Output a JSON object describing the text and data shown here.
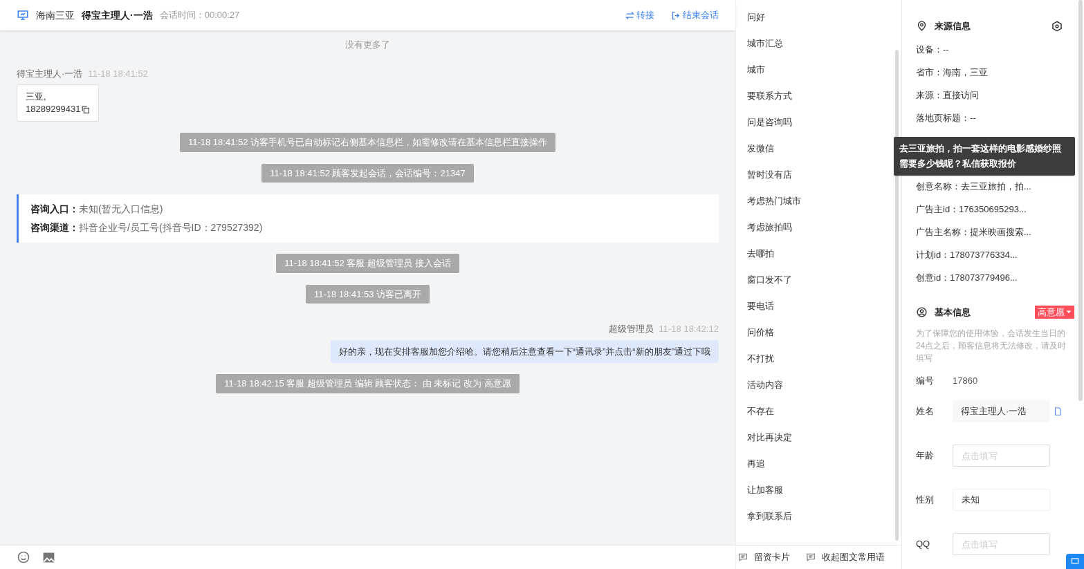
{
  "header": {
    "region": "海南三亚",
    "customer": "得宝主理人·一浩",
    "duration_label": "会话时间：",
    "duration": "00:00:27",
    "actions": [
      {
        "kind": "transfer",
        "label": "转接"
      },
      {
        "kind": "end",
        "label": "结束会话"
      }
    ]
  },
  "chat": {
    "no_more": "没有更多了",
    "items": [
      {
        "kind": "visitor",
        "sender": "得宝主理人·一浩",
        "time": "11-18 18:41:52",
        "lines": [
          "三亚,",
          "18289299431"
        ]
      },
      {
        "kind": "system",
        "text": "11-18 18:41:52 访客手机号已自动标记右侧基本信息栏，如需修改请在基本信息栏直接操作"
      },
      {
        "kind": "system",
        "text": "11-18 18:41:52 顾客发起会话，会话编号：21347"
      },
      {
        "kind": "info",
        "rows": [
          {
            "label": "咨询入口：",
            "value": "未知(暂无入口信息)"
          },
          {
            "label": "咨询渠道：",
            "value": "抖音企业号/员工号(抖音号ID：279527392)"
          }
        ]
      },
      {
        "kind": "system",
        "text": "11-18 18:41:52 客服 超级管理员 接入会话"
      },
      {
        "kind": "system",
        "text": "11-18 18:41:53 访客已离开"
      },
      {
        "kind": "agent",
        "sender": "超级管理员",
        "time": "11-18 18:42:12",
        "text": "好的亲，现在安排客服加您介绍哈。请您稍后注意查看一下“通讯录”并点击“新的朋友”通过下哦"
      },
      {
        "kind": "system",
        "text": "11-18 18:42:15 客服 超级管理员 编辑 顾客状态： 由 未标记 改为 高意愿"
      }
    ]
  },
  "toolbar": {
    "tools": [
      {
        "kind": "emoji"
      },
      {
        "kind": "image"
      }
    ],
    "links": [
      "留资卡片",
      "收起图文常用语"
    ]
  },
  "phrases": [
    "问好",
    "城市汇总",
    "城市",
    "要联系方式",
    "问是咨询吗",
    "发微信",
    "暂时没有店",
    "考虑热门城市",
    "考虑旅拍吗",
    "去哪拍",
    "窗口发不了",
    "要电话",
    "问价格",
    "不打扰",
    "活动内容",
    "不存在",
    "对比再决定",
    "再追",
    "让加客服",
    "拿到联系后"
  ],
  "source_info": {
    "title": "来源信息",
    "rows_top": [
      "设备：--",
      "省市：海南，三亚",
      "来源：直接访问",
      "落地页标题：--"
    ],
    "tooltip": "去三亚旅拍，拍一套这样的电影感婚纱照需要多少钱呢？私信获取报价",
    "rows_bottom": [
      "创意名称：去三亚旅拍，拍...",
      "广告主id：176350695293...",
      "广告主名称：提米映画搜索...",
      "计划id：178073776334...",
      "创意id：178073779496..."
    ]
  },
  "basic_info": {
    "title": "基本信息",
    "intent": "高意愿",
    "notice": "为了保障您的使用体验，会话发生当日的24点之后，顾客信息将无法修改，请及时填写",
    "fields": [
      {
        "kind": "text",
        "label": "编号",
        "value": "17860"
      },
      {
        "kind": "readonly",
        "label": "姓名",
        "value": "得宝主理人·一浩"
      },
      {
        "kind": "input",
        "label": "年龄",
        "placeholder": "点击填写"
      },
      {
        "kind": "select",
        "label": "性别",
        "value": "未知"
      },
      {
        "kind": "input",
        "label": "QQ",
        "placeholder": "点击填写"
      }
    ]
  }
}
